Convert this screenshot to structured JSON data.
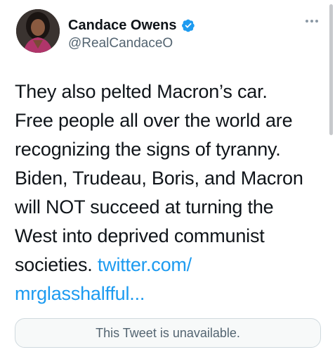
{
  "user": {
    "display_name": "Candace Owens",
    "handle": "@RealCandaceO",
    "verified": true
  },
  "tweet": {
    "lines": [
      "They also pelted Macron’s car.",
      "Free people all over the world are",
      "recognizing the signs of tyranny.",
      "Biden, Trudeau, Boris, and Macron",
      "will NOT succeed at turning the",
      "West into deprived communist"
    ],
    "last_line_prefix": "societies. ",
    "link_part1": "twitter.com/",
    "link_part2": "mrglasshalfful..."
  },
  "quoted": {
    "unavailable_text": "This Tweet is unavailable."
  },
  "colors": {
    "link": "#1d9bf0",
    "verified_badge": "#1d9bf0",
    "secondary_text": "#536471"
  },
  "icons": {
    "avatar": "profile-photo",
    "verified": "verified-badge-icon",
    "more": "more-options-icon"
  }
}
